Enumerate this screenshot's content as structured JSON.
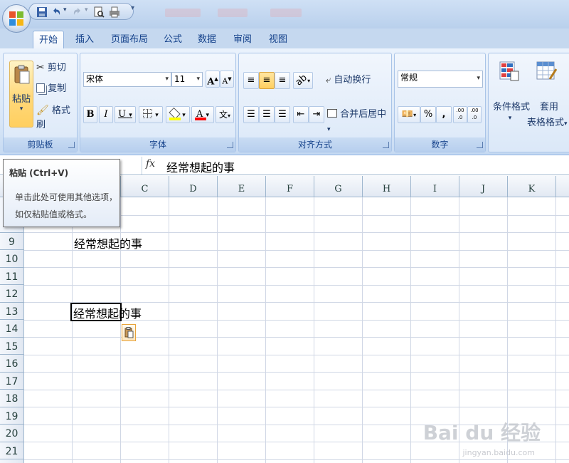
{
  "ribbon_tabs": [
    "开始",
    "插入",
    "页面布局",
    "公式",
    "数据",
    "审阅",
    "视图"
  ],
  "clipboard": {
    "paste_label": "粘贴",
    "cut_label": "剪切",
    "copy_label": "复制",
    "format_painter_label": "格式刷",
    "group_label": "剪贴板"
  },
  "font": {
    "name": "宋体",
    "size": "11",
    "grow": "A",
    "shrink": "A",
    "bold": "B",
    "italic": "I",
    "underline": "U",
    "color_letter": "A",
    "phonetic": "文",
    "group_label": "字体"
  },
  "alignment": {
    "wrap_text_label": "自动换行",
    "merge_center_label": "合并后居中",
    "group_label": "对齐方式"
  },
  "number": {
    "format": "常规",
    "percent": "%",
    "comma": ",",
    "inc_decimal": ".00 .0",
    "dec_decimal": ".00 .0",
    "group_label": "数字"
  },
  "styles": {
    "conditional_format_label": "条件格式",
    "table_format_line1": "套用",
    "table_format_line2": "表格格式"
  },
  "formula_bar": {
    "fx_label": "fx",
    "content": "经常想起的事"
  },
  "tooltip": {
    "title": "粘贴 (Ctrl+V)",
    "line1": "单击此处可使用其他选项，",
    "line2": "如仅粘贴值或格式。"
  },
  "sheet": {
    "columns": [
      "C",
      "D",
      "E",
      "F",
      "G",
      "H",
      "I",
      "J",
      "K"
    ],
    "rows": [
      "9",
      "10",
      "11",
      "12",
      "13",
      "14",
      "15",
      "16",
      "17",
      "18",
      "19",
      "20",
      "21"
    ],
    "cell_b9": "经常想起的事",
    "cell_b13_selected_part": "经常想起的",
    "cell_b13_rest": "事"
  },
  "watermark": {
    "brand": "Bai du 经验",
    "url": "jingyan.baidu.com"
  },
  "colors": {
    "ribbon_bg": "#d8e6f7",
    "group_label_bg": "#c9dcf3",
    "tab_text": "#15428b",
    "selected_button": "#ffcf60",
    "gridline": "#d0d7e5",
    "header_border": "#9eb6ce"
  }
}
